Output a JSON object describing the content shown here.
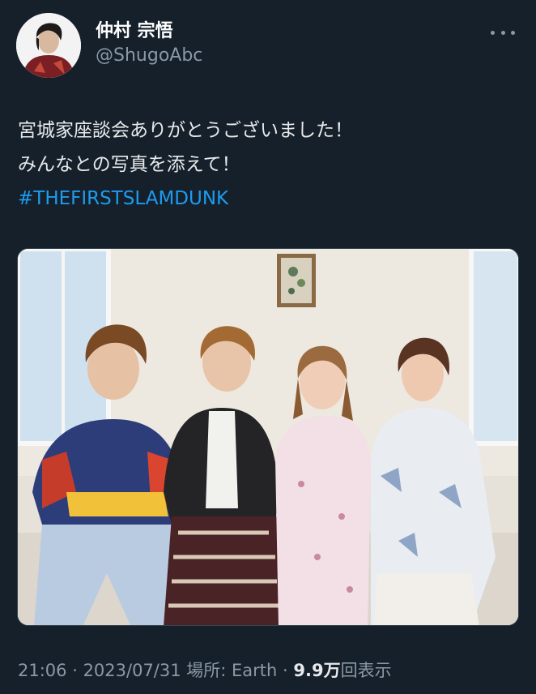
{
  "author": {
    "display_name": "仲村 宗悟",
    "handle": "@ShugoAbc",
    "avatar_icon": "profile-avatar"
  },
  "tweet": {
    "lines": [
      "宮城家座談会ありがとうございました！",
      "みんなとの写真を添えて！"
    ],
    "hashtag": "#THEFIRSTSLAMDUNK"
  },
  "meta": {
    "time": "21:06",
    "separator1": " · ",
    "date": "2023/07/31",
    "location": " 場所: Earth",
    "separator2": " · ",
    "views_number": "9.9",
    "views_unit": "万",
    "views_suffix": "回表示"
  },
  "colors": {
    "background": "#15202b",
    "text": "#e7e9ea",
    "secondary": "#8b98a5",
    "link": "#1d9bf0"
  },
  "icons": {
    "more": "more-options-icon"
  }
}
